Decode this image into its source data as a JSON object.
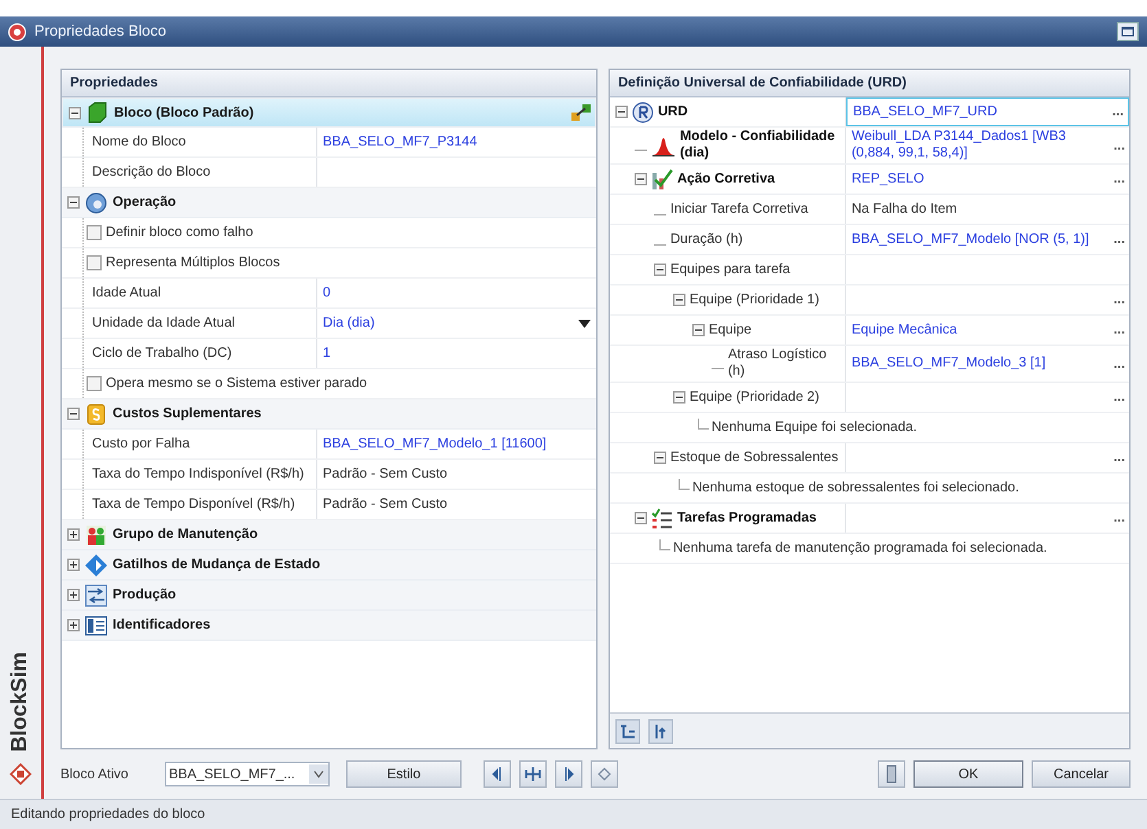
{
  "window": {
    "title": "Propriedades Bloco"
  },
  "side_label": "BlockSim",
  "properties": {
    "title": "Propriedades",
    "categories": [
      {
        "label": "Bloco (Bloco Padrão)",
        "expanded": true,
        "selected": true,
        "has_link": true,
        "rows": [
          {
            "kind": "field",
            "label": "Nome do Bloco",
            "value": "BBA_SELO_MF7_P3144",
            "linked": true
          },
          {
            "kind": "field",
            "label": "Descrição do Bloco"
          }
        ]
      },
      {
        "label": "Operação",
        "expanded": true,
        "selected": false,
        "rows": [
          {
            "kind": "check",
            "label": "Definir bloco como falho",
            "checked": false
          },
          {
            "kind": "check",
            "label": "Representa Múltiplos Blocos",
            "checked": false
          },
          {
            "kind": "field",
            "label": "Idade Atual",
            "value": "0",
            "linked": true
          },
          {
            "kind": "field",
            "label": "Unidade da Idade Atual",
            "value": "Dia (dia)",
            "linked": true,
            "dropdown": true
          },
          {
            "kind": "field",
            "label": "Ciclo de Trabalho (DC)",
            "value": "1",
            "linked": true
          },
          {
            "kind": "check",
            "label": "Opera mesmo se o Sistema estiver parado",
            "checked": false
          }
        ]
      },
      {
        "label": "Custos Suplementares",
        "expanded": true,
        "selected": false,
        "rows": [
          {
            "kind": "field",
            "label": "Custo por Falha",
            "value": "BBA_SELO_MF7_Modelo_1 [11600]",
            "linked": true
          },
          {
            "kind": "field",
            "label": "Taxa do Tempo Indisponível (R$/h)",
            "value": "Padrão - Sem Custo",
            "linked": false
          },
          {
            "kind": "field",
            "label": "Taxa de Tempo Disponível (R$/h)",
            "value": "Padrão - Sem Custo",
            "linked": false
          }
        ]
      },
      {
        "label": "Grupo de Manutenção",
        "expanded": false,
        "selected": false
      },
      {
        "label": "Gatilhos de Mudança de Estado",
        "expanded": false,
        "selected": false
      },
      {
        "label": "Produção",
        "expanded": false,
        "selected": false
      },
      {
        "label": "Identificadores",
        "expanded": false,
        "selected": false
      }
    ]
  },
  "urd": {
    "title": "Definição Universal de Confiabilidade (URD)",
    "tree": [
      {
        "kind": "node",
        "label": "URD",
        "bold": true,
        "value": "BBA_SELO_MF7_URD",
        "linked": true,
        "more": "...",
        "expanded": true,
        "selected": true,
        "children": [
          {
            "kind": "node",
            "label": "Modelo - Confiabilidade (dia)",
            "bold": true,
            "value": "Weibull_LDA P3144_Dados1 [WB3 (0,884, 99,1, 58,4)]",
            "linked": true,
            "more": "...",
            "selected": false
          },
          {
            "kind": "node",
            "label": "Ação Corretiva",
            "bold": true,
            "value": "REP_SELO",
            "linked": true,
            "more": "...",
            "expanded": true,
            "selected": false,
            "children": [
              {
                "kind": "node",
                "label": "Iniciar Tarefa Corretiva",
                "value": "Na Falha do Item",
                "linked": false,
                "selected": false
              },
              {
                "kind": "node",
                "label": "Duração (h)",
                "value": "BBA_SELO_MF7_Modelo [NOR (5, 1)]",
                "linked": true,
                "more": "...",
                "selected": false
              },
              {
                "kind": "node",
                "label": "Equipes para tarefa",
                "expanded": true,
                "selected": false,
                "children": [
                  {
                    "kind": "node",
                    "label": "Equipe (Prioridade 1)",
                    "more": "...",
                    "expanded": true,
                    "selected": false,
                    "children": [
                      {
                        "kind": "node",
                        "label": "Equipe",
                        "value": "Equipe Mecânica",
                        "linked": true,
                        "more": "...",
                        "expanded": true,
                        "selected": false,
                        "children": [
                          {
                            "kind": "node",
                            "label": "Atraso Logístico (h)",
                            "value": "BBA_SELO_MF7_Modelo_3 [1]",
                            "linked": true,
                            "more": "...",
                            "selected": false
                          }
                        ]
                      }
                    ]
                  },
                  {
                    "kind": "node",
                    "label": "Equipe (Prioridade 2)",
                    "more": "...",
                    "expanded": true,
                    "selected": false,
                    "children": [
                      {
                        "kind": "note",
                        "label": "Nenhuma Equipe foi selecionada."
                      }
                    ]
                  }
                ]
              },
              {
                "kind": "node",
                "label": "Estoque de Sobressalentes",
                "more": "...",
                "expanded": true,
                "selected": false,
                "children": [
                  {
                    "kind": "note",
                    "label": "Nenhuma estoque de sobressalentes foi selecionado."
                  }
                ]
              }
            ]
          },
          {
            "kind": "node",
            "label": "Tarefas Programadas",
            "bold": true,
            "more": "...",
            "expanded": true,
            "selected": false,
            "children": [
              {
                "kind": "note",
                "label": "Nenhuma tarefa de manutenção programada foi selecionada."
              }
            ]
          }
        ]
      }
    ]
  },
  "footer": {
    "active_label": "Bloco Ativo",
    "active_value": "BBA_SELO_MF7_...",
    "style_button": "Estilo",
    "ok": "OK",
    "cancel": "Cancelar"
  },
  "status_bar": "Editando propriedades do bloco"
}
